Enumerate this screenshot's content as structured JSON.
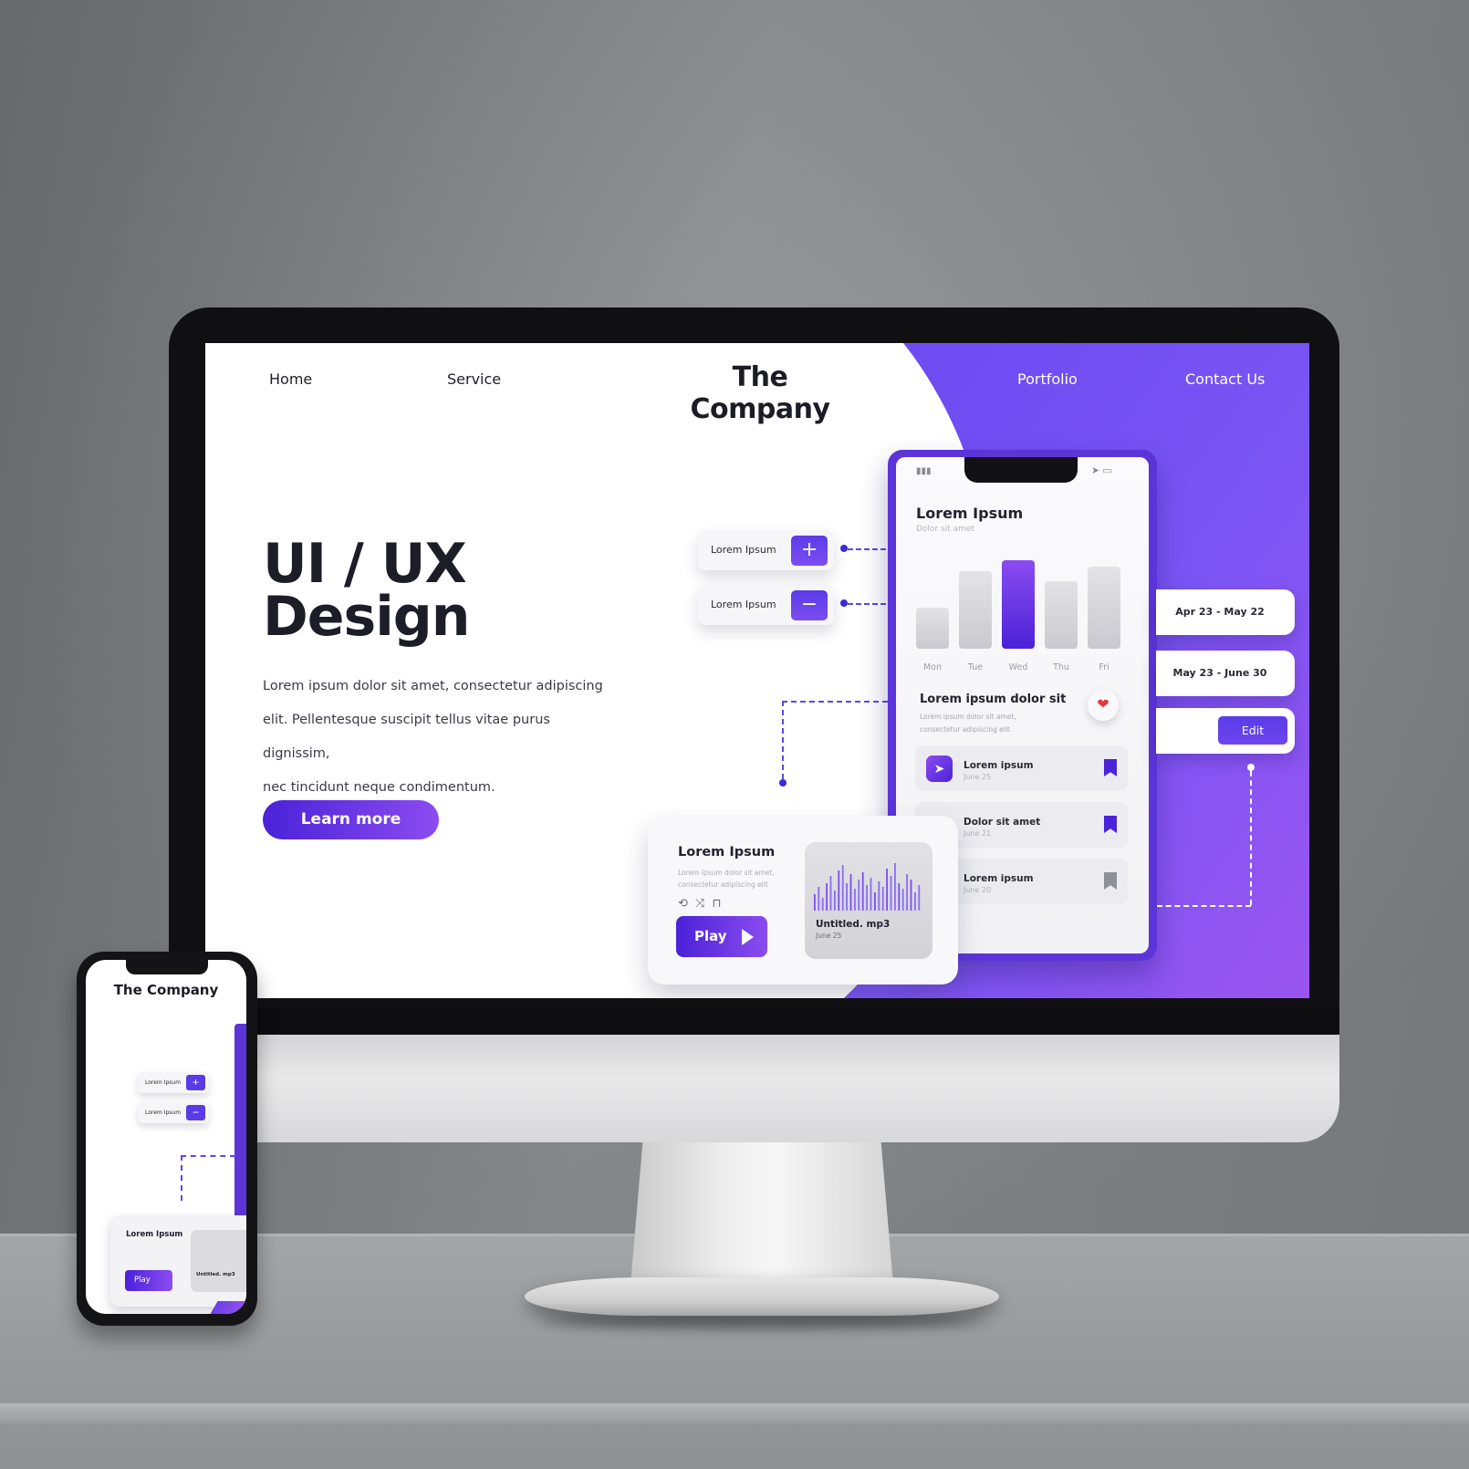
{
  "nav": {
    "home": "Home",
    "service": "Service",
    "brand": "The Company",
    "portfolio": "Portfolio",
    "contact": "Contact Us"
  },
  "hero": {
    "title_line1": "UI / UX",
    "title_line2": "Design",
    "paragraph_line1": "Lorem ipsum dolor sit amet, consectetur adipiscing",
    "paragraph_line2": "elit. Pellentesque suscipit tellus vitae purus dignissim,",
    "paragraph_line3": "nec tincidunt neque condimentum.",
    "cta_label": "Learn more"
  },
  "controls": [
    {
      "label": "Lorem Ipsum",
      "icon": "plus-icon",
      "glyph": "+"
    },
    {
      "label": "Lorem Ipsum",
      "icon": "minus-icon",
      "glyph": "−"
    }
  ],
  "phone_app": {
    "title": "Lorem Ipsum",
    "subtitle": "Dolor sit amet",
    "chart_data": {
      "type": "bar",
      "categories": [
        "Mon",
        "Tue",
        "Wed",
        "Thu",
        "Fri"
      ],
      "values": [
        45,
        85,
        97,
        74,
        90
      ],
      "highlighted": "Wed",
      "ylim": [
        0,
        100
      ]
    },
    "section_title": "Lorem ipsum dolor sit",
    "section_text_line1": "Lorem ipsum dolor sit amet,",
    "section_text_line2": "consectetur adipiscing elit",
    "list": [
      {
        "title": "Lorem ipsum",
        "date": "June 25",
        "icon": "navigation-arrow-icon",
        "bookmarked": true
      },
      {
        "title": "Dolor sit amet",
        "date": "June 21",
        "icon": "",
        "bookmarked": true
      },
      {
        "title": "Lorem ipsum",
        "date": "June 20",
        "icon": "",
        "bookmarked": false
      }
    ]
  },
  "date_cards": {
    "range1": "Apr 23 - May 22",
    "range2": "May 23 - June 30",
    "edit_label": "Edit"
  },
  "player": {
    "title": "Lorem Ipsum",
    "text_line1": "Lorem ipsum dolor sit amet,",
    "text_line2": "consectetur adipiscing elit",
    "play_label": "Play",
    "file_name": "Untitled. mp3",
    "file_date": "June 25"
  },
  "mobile": {
    "brand": "The Company",
    "control1": "Lorem Ipsum",
    "control2": "Lorem Ipsum",
    "player_title": "Lorem Ipsum",
    "play_label": "Play",
    "file_name": "Untitled. mp3"
  },
  "colors": {
    "accent_dark": "#4a22d8",
    "accent_light": "#8b4cf0",
    "heart": "#e8363d"
  }
}
